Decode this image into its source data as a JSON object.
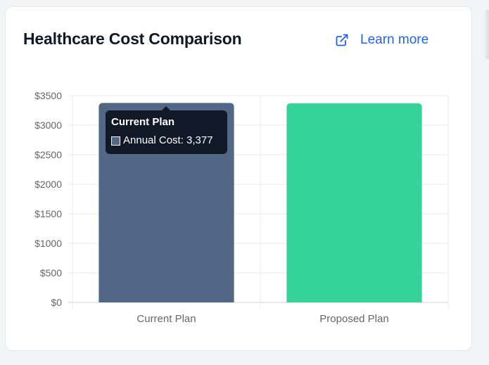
{
  "header": {
    "title": "Healthcare Cost Comparison",
    "learn_more_label": "Learn more",
    "learn_more_icon": "external-link-icon"
  },
  "tooltip": {
    "title": "Current Plan",
    "label": "Annual Cost: 3,377"
  },
  "colors": {
    "current": "#526785",
    "proposed": "#34d399",
    "accent": "#2563eb"
  },
  "chart_data": {
    "type": "bar",
    "categories": [
      "Current Plan",
      "Proposed Plan"
    ],
    "series": [
      {
        "name": "Annual Cost",
        "values": [
          3377,
          3370
        ]
      }
    ],
    "title": "",
    "xlabel": "",
    "ylabel": "",
    "ylim": [
      0,
      3500
    ],
    "y_ticks": [
      "$0",
      "$500",
      "$1000",
      "$1500",
      "$2000",
      "$2500",
      "$3000",
      "$3500"
    ],
    "grid": true,
    "legend": "none"
  }
}
